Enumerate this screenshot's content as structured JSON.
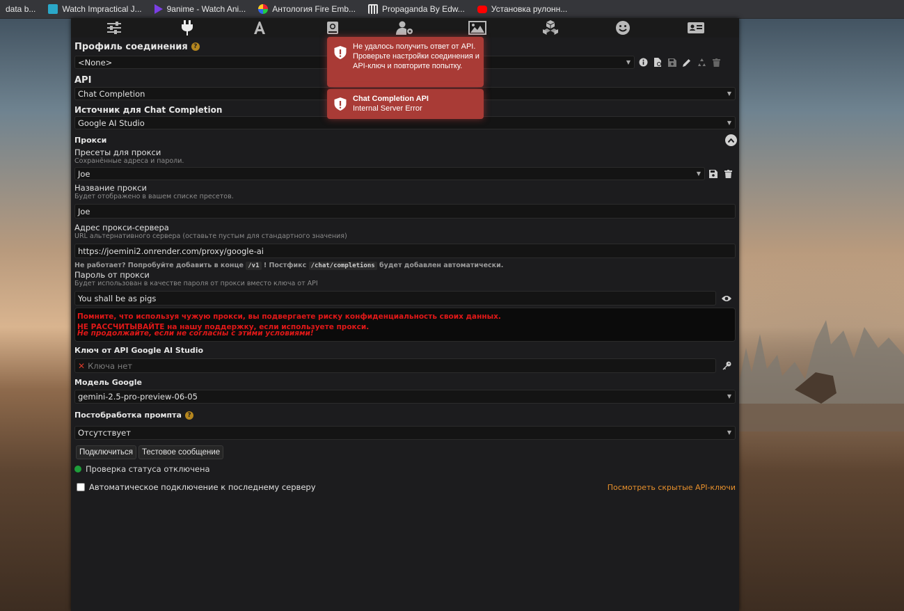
{
  "bookmarks": [
    {
      "label": "data b...",
      "color": "#35363a"
    },
    {
      "label": "Watch Impractical J...",
      "color": "#2aa8c9"
    },
    {
      "label": "9anime - Watch Ani...",
      "color": "#7b3fe4"
    },
    {
      "label": "Антология Fire Emb...",
      "color": "#d24a8a"
    },
    {
      "label": "Propaganda By Edw...",
      "color": "#e8e8e8"
    },
    {
      "label": "Установка рулонн...",
      "color": "#ff0000"
    }
  ],
  "nav_icons": [
    "sliders-icon",
    "plug-icon",
    "font-icon",
    "book-icon",
    "user-gear-icon",
    "image-icon",
    "cubes-icon",
    "smile-icon",
    "id-card-icon"
  ],
  "profile": {
    "title": "Профиль соединения",
    "help": "?",
    "value": "<None>"
  },
  "api": {
    "label": "API",
    "value": "Chat Completion"
  },
  "source": {
    "label": "Источник для Chat Completion",
    "value": "Google AI Studio"
  },
  "proxy": {
    "label": "Прокси",
    "presets_label": "Пресеты для прокси",
    "presets_hint": "Сохранённые адреса и пароли.",
    "preset_value": "Joe",
    "name_label": "Название прокси",
    "name_hint": "Будет отображено в вашем списке пресетов.",
    "name_value": "Joe",
    "url_label": "Адрес прокси-сервера",
    "url_hint": "URL альтернативного сервера (оставьте пустым для стандартного значения)",
    "url_value": "https://joemini2.onrender.com/proxy/google-ai",
    "tip_prefix": "Не работает? Попробуйте добавить в конце",
    "tip_code1": "/v1",
    "tip_mid": "! Постфикс",
    "tip_code2": "/chat/completions",
    "tip_suffix": "будет добавлен автоматически.",
    "password_label": "Пароль от прокси",
    "password_hint": "Будет использован в качестве пароля от прокси вместо ключа от API",
    "password_value": "You shall be as pigs",
    "warning_line1": "Помните, что используя чужую прокси, вы подвергаете риску конфиденциальность своих данных.",
    "warning_line2": "НЕ РАССЧИТЫВАЙТЕ на нашу поддержку, если используете прокси.",
    "warning_line3": "Не продолжайте, если не согласны с этими условиями!"
  },
  "key": {
    "label": "Ключ от API Google AI Studio",
    "x": "✕",
    "placeholder": "Ключа нет"
  },
  "model": {
    "label": "Модель Google",
    "value": "gemini-2.5-pro-preview-06-05"
  },
  "postprocess": {
    "label": "Постобработка промпта",
    "help": "?",
    "value": "Отсутствует"
  },
  "buttons": {
    "connect": "Подключиться",
    "test": "Тестовое сообщение"
  },
  "status": {
    "text": "Проверка статуса отключена",
    "color": "#1e9e3a"
  },
  "auto": {
    "label": "Автоматическое подключение к последнему серверу"
  },
  "hidden_keys": "Посмотреть скрытые API-ключи",
  "toasts": [
    {
      "title": "",
      "text": "Не удалось получить ответ от API. Проверьте настройки соединения и API-ключ и повторите попытку."
    },
    {
      "title": "Chat Completion API",
      "text": "Internal Server Error"
    }
  ]
}
